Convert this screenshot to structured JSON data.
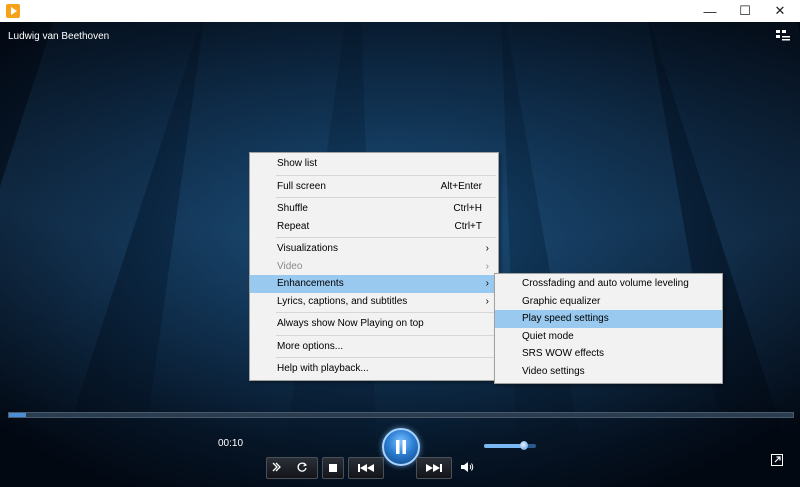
{
  "window": {
    "app_icon": "media-player-icon",
    "minimize_glyph": "—",
    "maximize_glyph": "☐",
    "close_glyph": "✕"
  },
  "now_playing": {
    "title": "Ludwig van Beethoven"
  },
  "context_menu": {
    "items": [
      {
        "label": "Show list"
      },
      {
        "label": "Full screen",
        "shortcut": "Alt+Enter"
      },
      {
        "label": "Shuffle",
        "shortcut": "Ctrl+H"
      },
      {
        "label": "Repeat",
        "shortcut": "Ctrl+T"
      },
      {
        "label": "Visualizations"
      },
      {
        "label": "Video"
      },
      {
        "label": "Enhancements"
      },
      {
        "label": "Lyrics, captions, and subtitles"
      },
      {
        "label": "Always show Now Playing on top"
      },
      {
        "label": "More options..."
      },
      {
        "label": "Help with playback..."
      }
    ]
  },
  "submenu": {
    "items": [
      {
        "label": "Crossfading and auto volume leveling"
      },
      {
        "label": "Graphic equalizer"
      },
      {
        "label": "Play speed settings"
      },
      {
        "label": "Quiet mode"
      },
      {
        "label": "SRS WOW effects"
      },
      {
        "label": "Video settings"
      }
    ]
  },
  "controls": {
    "elapsed": "00:10",
    "seek_progress_fraction": 0.022,
    "volume_fraction": 0.77
  },
  "colors": {
    "highlight": "#99c9ef",
    "accent": "#2c7fd4"
  }
}
